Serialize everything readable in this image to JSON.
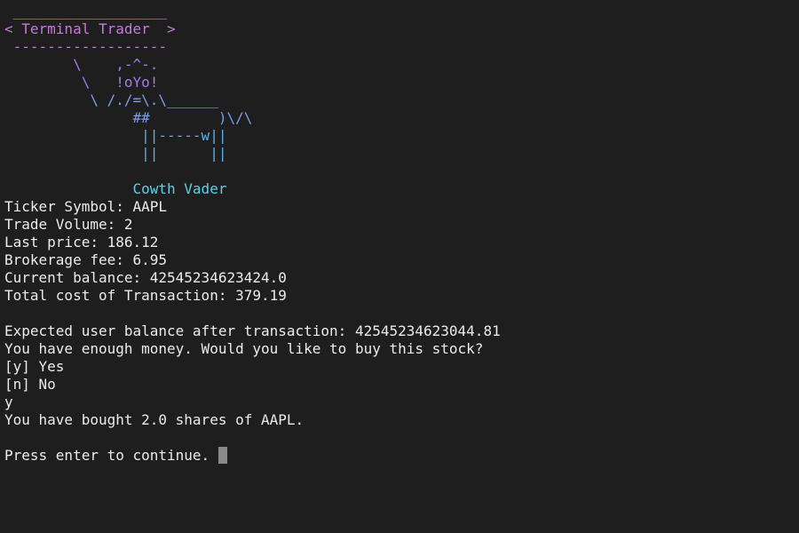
{
  "banner": {
    "top_rule": " __________________",
    "title_line": "< Terminal Trader  >",
    "bottom_rule": " ------------------"
  },
  "ascii_art": {
    "line1": "        \\    ,-^-.",
    "line2": "         \\   !oYo!",
    "line3": "          \\ /./=\\.\\______",
    "line4": "               ##        )\\/\\",
    "line5": "                ||-----w||",
    "line6": "                ||      ||",
    "caption": "               Cowth Vader"
  },
  "trade": {
    "ticker": "Ticker Symbol: AAPL",
    "volume": "Trade Volume: 2",
    "last_price": "Last price: 186.12",
    "fee": "Brokerage fee: 6.95",
    "balance": "Current balance: 42545234623424.0",
    "total_cost": "Total cost of Transaction: 379.19"
  },
  "confirm": {
    "expected_balance": "Expected user balance after transaction: 42545234623044.81",
    "question": "You have enough money. Would you like to buy this stock?",
    "option_yes": "[y] Yes",
    "option_no": "[n] No",
    "user_input": "y",
    "result": "You have bought 2.0 shares of AAPL."
  },
  "prompt": {
    "text": "Press enter to continue. "
  },
  "colors": {
    "background": "#1e1e1e",
    "text": "#ececec",
    "banner_pink": "#c678dd",
    "art_blue": "#7b9cf0",
    "caption_cyan": "#5fd0e6",
    "cursor": "#8a8a8a"
  }
}
